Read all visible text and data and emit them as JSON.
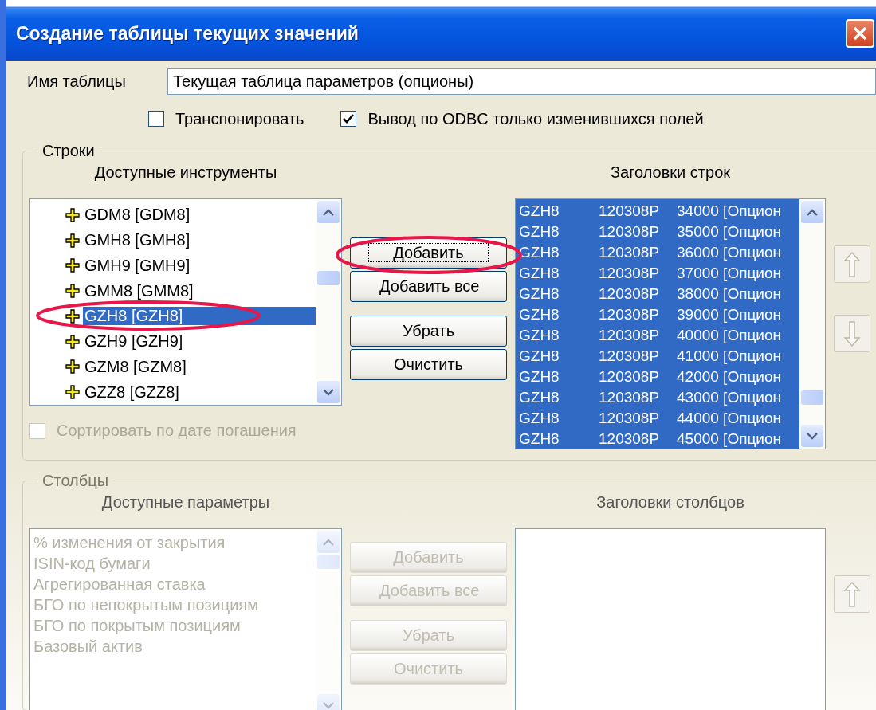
{
  "window": {
    "title": "Создание таблицы текущих значений"
  },
  "table_name": {
    "label": "Имя таблицы",
    "value": "Текущая таблица параметров (опционы)"
  },
  "options": [
    {
      "label": "Транспонировать",
      "checked": false
    },
    {
      "label": "Вывод по ODBC только изменившихся  полей",
      "checked": true
    }
  ],
  "rows_group": {
    "title": "Строки",
    "disabled": false,
    "available": {
      "heading": "Доступные инструменты",
      "items": [
        {
          "label": "GDM8 [GDM8]",
          "selected": false
        },
        {
          "label": "GMH8 [GMH8]",
          "selected": false
        },
        {
          "label": "GMH9 [GMH9]",
          "selected": false
        },
        {
          "label": "GMM8 [GMM8]",
          "selected": false
        },
        {
          "label": "GZH8 [GZH8]",
          "selected": true
        },
        {
          "label": "GZH9 [GZH9]",
          "selected": false
        },
        {
          "label": "GZM8 [GZM8]",
          "selected": false
        },
        {
          "label": "GZZ8 [GZZ8]",
          "selected": false
        }
      ]
    },
    "buttons": [
      {
        "label": "Добавить",
        "focused": true
      },
      {
        "label": "Добавить все",
        "focused": false
      },
      {
        "label": "Убрать",
        "focused": false
      },
      {
        "label": "Очистить",
        "focused": false
      }
    ],
    "headers": {
      "heading": "Заголовки строк",
      "items": [
        {
          "col_1": "GZH8",
          "col_2": "120308P",
          "col_3": "34000 [Опцион",
          "selected": true
        },
        {
          "col_1": "GZH8",
          "col_2": "120308P",
          "col_3": "35000 [Опцион",
          "selected": true
        },
        {
          "col_1": "GZH8",
          "col_2": "120308P",
          "col_3": "36000 [Опцион",
          "selected": true
        },
        {
          "col_1": "GZH8",
          "col_2": "120308P",
          "col_3": "37000 [Опцион",
          "selected": true
        },
        {
          "col_1": "GZH8",
          "col_2": "120308P",
          "col_3": "38000 [Опцион",
          "selected": true
        },
        {
          "col_1": "GZH8",
          "col_2": "120308P",
          "col_3": "39000 [Опцион",
          "selected": true
        },
        {
          "col_1": "GZH8",
          "col_2": "120308P",
          "col_3": "40000 [Опцион",
          "selected": true
        },
        {
          "col_1": "GZH8",
          "col_2": "120308P",
          "col_3": "41000 [Опцион",
          "selected": true
        },
        {
          "col_1": "GZH8",
          "col_2": "120308P",
          "col_3": "42000 [Опцион",
          "selected": true
        },
        {
          "col_1": "GZH8",
          "col_2": "120308P",
          "col_3": "43000 [Опцион",
          "selected": true
        },
        {
          "col_1": "GZH8",
          "col_2": "120308P",
          "col_3": "44000 [Опцион",
          "selected": true
        },
        {
          "col_1": "GZH8",
          "col_2": "120308P",
          "col_3": "45000 [Опцион",
          "selected": true
        }
      ]
    },
    "move_buttons": [
      {
        "kind": "up",
        "disabled": true
      },
      {
        "kind": "down",
        "disabled": true
      }
    ],
    "sort": {
      "label": "Сортировать по дате погашения",
      "checked": false
    }
  },
  "columns_group": {
    "title": "Столбцы",
    "disabled": true,
    "available": {
      "heading": "Доступные параметры",
      "items": [
        {
          "label": "% изменения от закрытия",
          "selected": false
        },
        {
          "label": "ISIN-код бумаги",
          "selected": false
        },
        {
          "label": "Агрегированная ставка",
          "selected": false
        },
        {
          "label": "БГО по непокрытым позициям",
          "selected": false
        },
        {
          "label": "БГО по покрытым позициям",
          "selected": false
        },
        {
          "label": "Базовый актив",
          "selected": false
        }
      ]
    },
    "buttons": [
      {
        "label": "Добавить",
        "focused": false
      },
      {
        "label": "Добавить все",
        "focused": false
      },
      {
        "label": "Убрать",
        "focused": false
      },
      {
        "label": "Очистить",
        "focused": false
      }
    ],
    "headers": {
      "heading": "Заголовки столбцов"
    },
    "move_buttons": [
      {
        "kind": "up",
        "disabled": true
      }
    ]
  }
}
